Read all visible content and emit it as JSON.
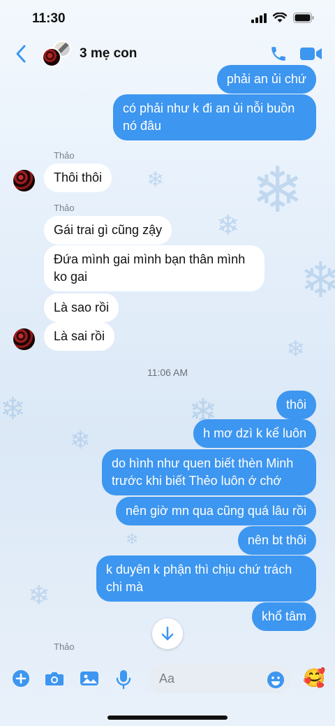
{
  "status": {
    "time": "11:30"
  },
  "header": {
    "title": "3 mẹ con",
    "icons": [
      "back-chevron-icon",
      "group-avatar",
      "phone-icon",
      "video-camera-icon"
    ]
  },
  "messages": {
    "m1": "phải an ủi chứ",
    "m2": "có phải như k đi an ủi nỗi buồn nó đâu",
    "sender1": "Thảo",
    "m3": "Thôi thôi",
    "sender2": "Thảo",
    "m4": "Gái trai gì cũng zậy",
    "m5": "Đứa mình gai mình bạn thân mình ko gai",
    "m6": "Là sao rồi",
    "m7": "Là sai rồi",
    "timestamp": "11:06 AM",
    "m8": "thôi",
    "m9": "h mơ dzì k kể luôn",
    "m10": "do hình như quen biết thèn Minh trước khi biết Thẻo luôn ớ chớ",
    "m11": "nên giờ mn qua cũng quá lâu rồi",
    "m12": "nên bt thôi",
    "m13": "k duyên k phận thì chịu chứ trách chi mà",
    "m14": "khổ tâm",
    "sender3": "Thảo"
  },
  "composer": {
    "placeholder": "Aa",
    "icons": [
      "plus-icon",
      "camera-icon",
      "photo-icon",
      "microphone-icon",
      "emoji-icon",
      "sticker-emoji"
    ]
  },
  "colors": {
    "accent": "#3d96f0",
    "incoming_bubble": "#ffffff",
    "background": "#e6f0fb"
  }
}
